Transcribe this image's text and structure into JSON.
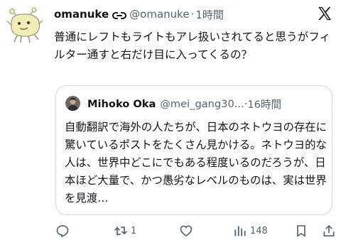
{
  "post": {
    "author_name": "omanuke",
    "handle": "@omanuke",
    "separator": "·",
    "time": "1時間",
    "text": "普通にレフトもライトもアレ扱いされてると思うがフィルター通すと右だけ目に入ってくるの？"
  },
  "quote": {
    "author_name": "Mihoko Oka",
    "handle": "@mei_gang30...",
    "separator": "·",
    "time": "16時間",
    "text": "自動翻訳で海外の人たちが、日本のネトウヨの存在に驚いているポストをたくさん見かける。ネトウヨ的な人は、世界中どこにでもある程度いるのだろうが、日本ほど大量で、かつ愚劣なレベルのものは、実は世界を見渡…"
  },
  "actions": {
    "reply_count": "",
    "repost_count": "1",
    "like_count": "",
    "views_count": "148"
  },
  "icons": {
    "avatar": "cartoon-character-avatar",
    "badge": "link-badge-icon",
    "logo": "x-logo-icon",
    "reply": "reply-icon",
    "repost": "repost-icon",
    "like": "heart-icon",
    "views": "views-icon",
    "bookmark": "bookmark-icon",
    "share": "share-icon"
  },
  "colors": {
    "text": "#0f1419",
    "secondary": "#536471",
    "border": "#cfd9de",
    "avatar_fill": "#f2ecb6"
  }
}
